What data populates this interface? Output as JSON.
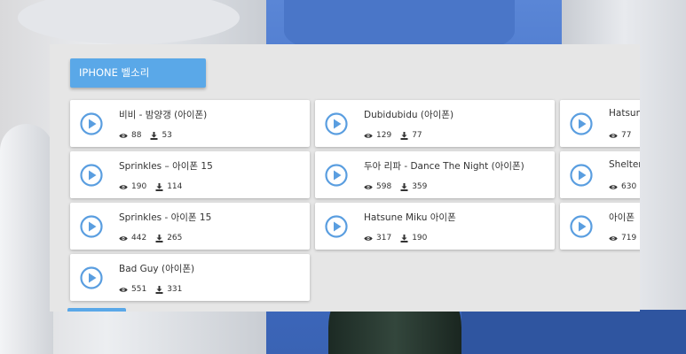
{
  "panel": {
    "title": "IPHONE 벨소리"
  },
  "ringtones": [
    {
      "title": "비비 - 밤양갱 (아이폰)",
      "views": "88",
      "downloads": "53",
      "col": 0,
      "row": 0
    },
    {
      "title": "Dubidubidu (아이폰)",
      "views": "129",
      "downloads": "77",
      "col": 1,
      "row": 0
    },
    {
      "title": "Hatsune",
      "views": "77",
      "downloads": "",
      "col": 2,
      "row": 0
    },
    {
      "title": "Sprinkles – 아이폰 15",
      "views": "190",
      "downloads": "114",
      "col": 0,
      "row": 1
    },
    {
      "title": "두아 리파 - Dance The Night (아이폰)",
      "views": "598",
      "downloads": "359",
      "col": 1,
      "row": 1
    },
    {
      "title": "Shelter",
      "views": "630",
      "downloads": "",
      "col": 2,
      "row": 1
    },
    {
      "title": "Sprinkles - 아이폰 15",
      "views": "442",
      "downloads": "265",
      "col": 0,
      "row": 2
    },
    {
      "title": "Hatsune Miku 아이폰",
      "views": "317",
      "downloads": "190",
      "col": 1,
      "row": 2
    },
    {
      "title": "아이폰",
      "views": "719",
      "downloads": "",
      "col": 2,
      "row": 2
    },
    {
      "title": "Bad Guy (아이폰)",
      "views": "551",
      "downloads": "331",
      "col": 0,
      "row": 3
    }
  ],
  "icons": {
    "play": "play-circle-icon",
    "views": "eye-icon",
    "downloads": "download-icon"
  },
  "colors": {
    "accent": "#5aa8e8",
    "play_icon": "#5a9ee0"
  }
}
